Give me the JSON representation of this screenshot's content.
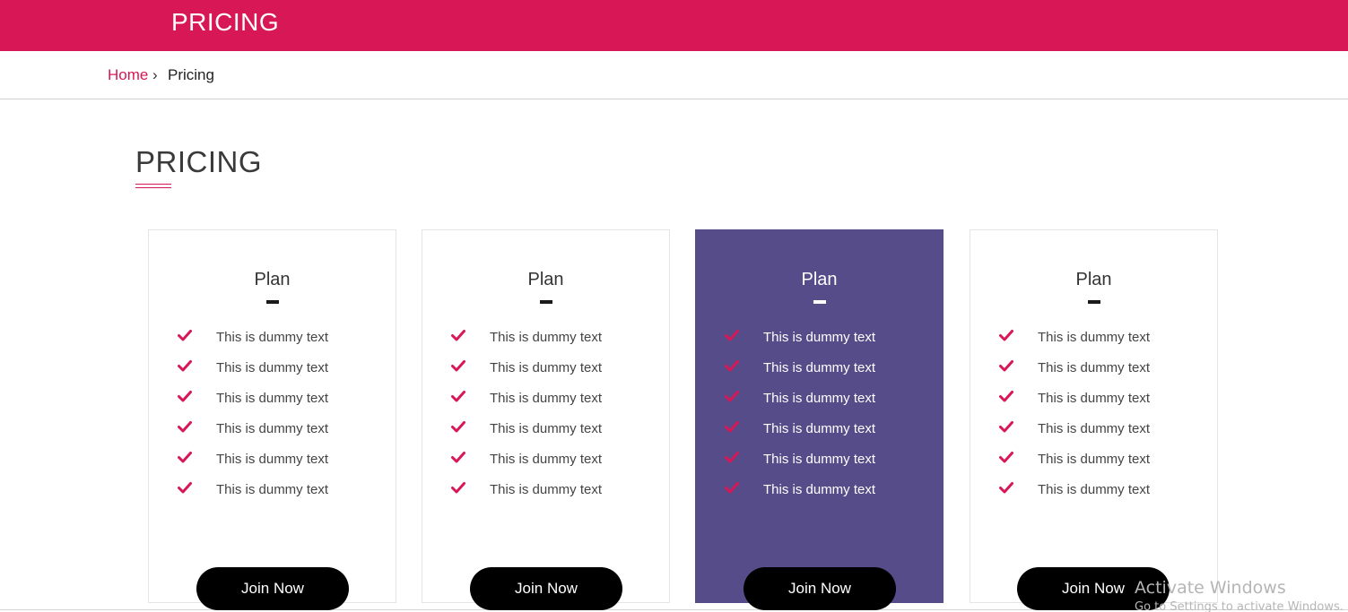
{
  "header": {
    "title": "PRICING"
  },
  "breadcrumb": {
    "home": "Home",
    "separator": "›",
    "current": "Pricing"
  },
  "section": {
    "title": "PRICING"
  },
  "colors": {
    "brand": "#d81756",
    "featured": "#564c89",
    "button": "#000000"
  },
  "cards": [
    {
      "plan": "Plan",
      "featured": false,
      "button": "Join Now",
      "features": [
        "This is dummy text",
        "This is dummy text",
        "This is dummy text",
        "This is dummy text",
        "This is dummy text",
        "This is dummy text"
      ]
    },
    {
      "plan": "Plan",
      "featured": false,
      "button": "Join Now",
      "features": [
        "This is dummy text",
        "This is dummy text",
        "This is dummy text",
        "This is dummy text",
        "This is dummy text",
        "This is dummy text"
      ]
    },
    {
      "plan": "Plan",
      "featured": true,
      "button": "Join Now",
      "features": [
        "This is dummy text",
        "This is dummy text",
        "This is dummy text",
        "This is dummy text",
        "This is dummy text",
        "This is dummy text"
      ]
    },
    {
      "plan": "Plan",
      "featured": false,
      "button": "Join Now",
      "features": [
        "This is dummy text",
        "This is dummy text",
        "This is dummy text",
        "This is dummy text",
        "This is dummy text",
        "This is dummy text"
      ]
    }
  ],
  "icons": {
    "feature": "check-icon"
  },
  "watermark": {
    "line1": "Activate Windows",
    "line2": "Go to Settings to activate Windows."
  }
}
